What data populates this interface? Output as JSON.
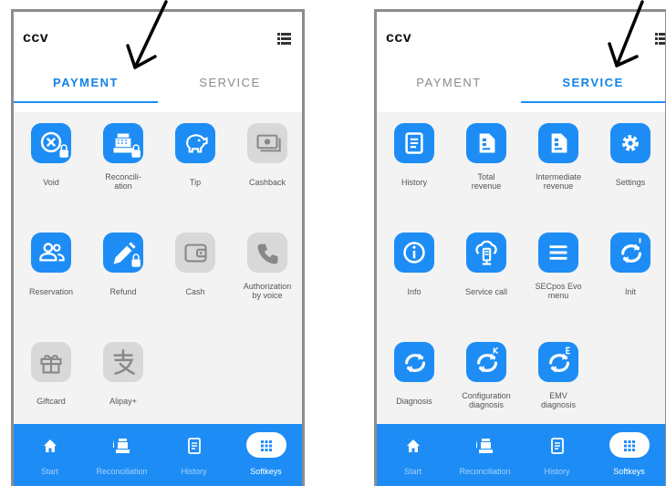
{
  "payment_screen": {
    "logo": "ccv",
    "tabs": [
      "PAYMENT",
      "SERVICE"
    ],
    "active_tab": "PAYMENT",
    "keys": [
      {
        "label": "Void",
        "icon": "void-lock-icon",
        "enabled": true
      },
      {
        "label": "Reconcili-\nation",
        "icon": "register-lock-icon",
        "enabled": true
      },
      {
        "label": "Tip",
        "icon": "piggy-bank-icon",
        "enabled": true
      },
      {
        "label": "Cashback",
        "icon": "cashback-icon",
        "enabled": false
      },
      {
        "label": "Reservation",
        "icon": "people-icon",
        "enabled": true
      },
      {
        "label": "Refund",
        "icon": "edit-lock-icon",
        "enabled": true
      },
      {
        "label": "Cash",
        "icon": "wallet-icon",
        "enabled": false
      },
      {
        "label": "Authorization\nby voice",
        "icon": "phone-icon",
        "enabled": false
      },
      {
        "label": "Giftcard",
        "icon": "gift-icon",
        "enabled": false
      },
      {
        "label": "Alipay+",
        "icon": "alipay-icon",
        "enabled": false
      }
    ]
  },
  "service_screen": {
    "logo": "ccv",
    "tabs": [
      "PAYMENT",
      "SERVICE"
    ],
    "active_tab": "SERVICE",
    "keys": [
      {
        "label": "History",
        "icon": "list-icon",
        "enabled": true
      },
      {
        "label": "Total\nrevenue",
        "icon": "document-icon",
        "enabled": true
      },
      {
        "label": "Intermediate\nrevenue",
        "icon": "document-icon",
        "enabled": true
      },
      {
        "label": "Settings",
        "icon": "gear-icon",
        "enabled": true
      },
      {
        "label": "Info",
        "icon": "info-icon",
        "enabled": true
      },
      {
        "label": "Service call",
        "icon": "cloud-terminal-icon",
        "enabled": true
      },
      {
        "label": "SECpos Evo\nmenu",
        "icon": "hamburger-icon",
        "enabled": true
      },
      {
        "label": "Init",
        "icon": "sync-init-icon",
        "enabled": true
      },
      {
        "label": "Diagnosis",
        "icon": "sync-icon",
        "enabled": true
      },
      {
        "label": "Configuration\ndiagnosis",
        "icon": "sync-k-icon",
        "enabled": true
      },
      {
        "label": "EMV\ndiagnosis",
        "icon": "sync-e-icon",
        "enabled": true
      }
    ]
  },
  "bottom_nav": [
    {
      "label": "Start",
      "icon": "home-icon"
    },
    {
      "label": "Reconciliation",
      "icon": "register-lock-icon"
    },
    {
      "label": "History",
      "icon": "list-icon"
    },
    {
      "label": "Softkeys",
      "icon": "grid-icon"
    }
  ],
  "active_nav": "Softkeys",
  "colors": {
    "accent": "#1d8df5",
    "disabled": "#d8d8d8",
    "background": "#f3f3f3",
    "frame": "#8d8d8d"
  }
}
